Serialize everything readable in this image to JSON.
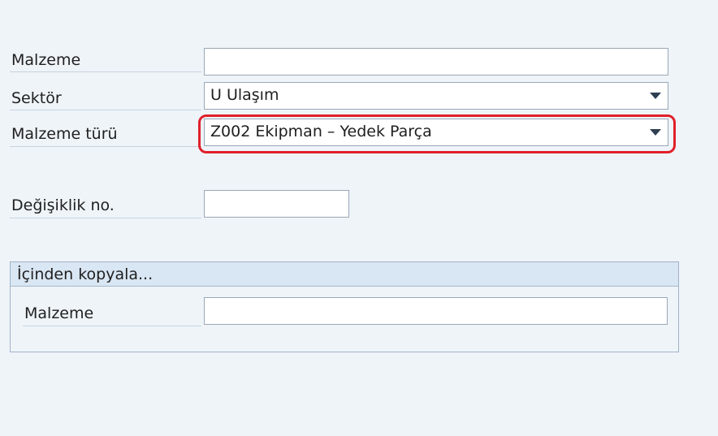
{
  "form": {
    "malzeme": {
      "label": "Malzeme",
      "value": ""
    },
    "sektor": {
      "label": "Sektör",
      "value": "U Ulaşım"
    },
    "malzeme_turu": {
      "label": "Malzeme türü",
      "value": "Z002 Ekipman – Yedek Parça"
    },
    "degisiklik_no": {
      "label": "Değişiklik no.",
      "value": ""
    }
  },
  "copy_from": {
    "title": "İçinden kopyala...",
    "malzeme": {
      "label": "Malzeme",
      "value": ""
    }
  },
  "colors": {
    "background": "#eff4f9",
    "highlight_border": "#e0202a",
    "group_header": "#d9e6f3"
  },
  "icons": {
    "dropdown": "chevron-down-icon"
  }
}
